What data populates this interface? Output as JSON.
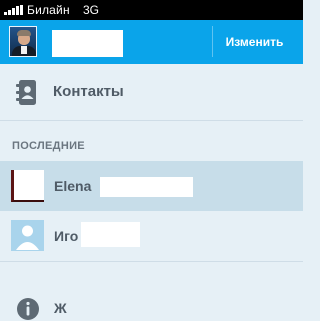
{
  "status_bar": {
    "carrier": "Билайн",
    "network": "3G",
    "signal_icon": "signal-bars-icon"
  },
  "header": {
    "edit_label": "Изменить",
    "background_color": "#0aa4ea"
  },
  "menu": {
    "contacts_label": "Контакты",
    "contacts_icon": "address-book-icon"
  },
  "recent": {
    "section_title": "ПОСЛЕДНИЕ",
    "items": [
      {
        "name": "Elena",
        "avatar": "contact-photo",
        "selected": true
      },
      {
        "name": "Иго",
        "avatar": "placeholder-avatar-icon",
        "selected": false
      }
    ]
  },
  "bottom": {
    "label": "Ж",
    "icon": "info-icon"
  }
}
